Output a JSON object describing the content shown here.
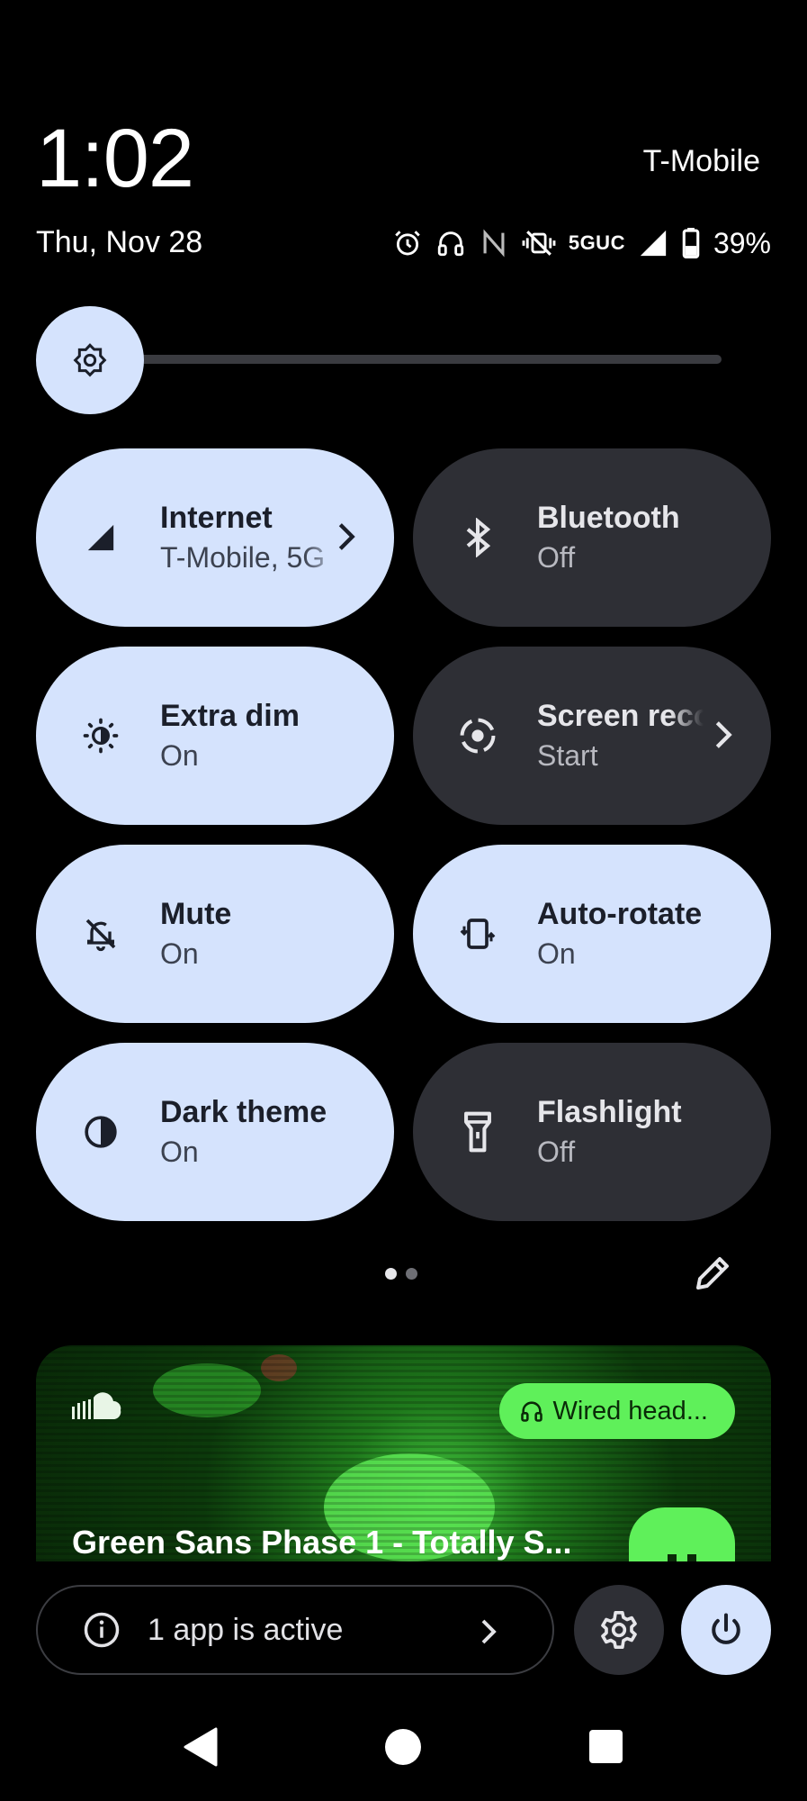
{
  "status": {
    "time": "1:02",
    "date": "Thu, Nov 28",
    "carrier": "T-Mobile",
    "network": "5GUC",
    "battery": "39%",
    "icons": [
      "alarm-icon",
      "headphones-icon",
      "nfc-icon",
      "vibrate-off-icon",
      "signal-icon",
      "battery-icon"
    ]
  },
  "brightness": {
    "icon": "brightness-icon",
    "level": 0.08
  },
  "tiles": [
    {
      "label": "Internet",
      "sub": "T-Mobile, 5G",
      "state": "on",
      "icon": "cell-signal-icon",
      "chevron": true
    },
    {
      "label": "Bluetooth",
      "sub": "Off",
      "state": "off",
      "icon": "bluetooth-icon",
      "chevron": false
    },
    {
      "label": "Extra dim",
      "sub": "On",
      "state": "on",
      "icon": "extra-dim-icon",
      "chevron": false
    },
    {
      "label": "Screen record",
      "sub": "Start",
      "state": "off",
      "icon": "screen-record-icon",
      "chevron": true
    },
    {
      "label": "Mute",
      "sub": "On",
      "state": "on",
      "icon": "bell-off-icon",
      "chevron": false
    },
    {
      "label": "Auto-rotate",
      "sub": "On",
      "state": "on",
      "icon": "rotate-icon",
      "chevron": false
    },
    {
      "label": "Dark theme",
      "sub": "On",
      "state": "on",
      "icon": "dark-theme-icon",
      "chevron": false
    },
    {
      "label": "Flashlight",
      "sub": "Off",
      "state": "off",
      "icon": "flashlight-icon",
      "chevron": false
    }
  ],
  "pager": {
    "pages": 2,
    "current": 1
  },
  "media": {
    "title": "Green Sans Phase 1 - Totally S...",
    "output_chip": "Wired head...",
    "source_icon": "soundcloud-icon",
    "state": "playing"
  },
  "footer": {
    "active_apps": "1 app is active"
  },
  "colors": {
    "tile_on": "#d5e3fd",
    "tile_off": "#2e2f35",
    "media_accent": "#5ff05a",
    "background": "#000000"
  }
}
